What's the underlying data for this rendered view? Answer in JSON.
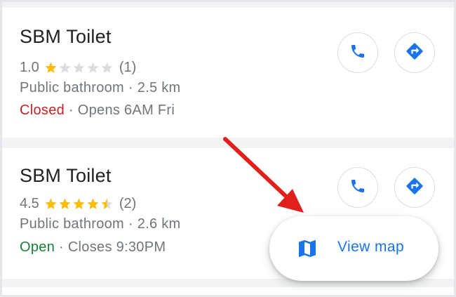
{
  "results": [
    {
      "name": "SBM Toilet",
      "rating": "1.0",
      "stars": [
        1,
        0,
        0,
        0,
        0
      ],
      "review_count": "(1)",
      "category_distance": "Public bathroom · 2.5 km",
      "status": "Closed",
      "status_detail": " · Opens 6AM Fri",
      "call_icon": "phone-icon",
      "directions_icon": "directions-icon"
    },
    {
      "name": "SBM Toilet",
      "rating": "4.5",
      "stars": [
        1,
        1,
        1,
        1,
        0.5
      ],
      "review_count": "(2)",
      "category_distance": "Public bathroom · 2.6 km",
      "status": "Open",
      "status_detail": " · Closes 9:30PM",
      "call_icon": "phone-icon",
      "directions_icon": "directions-icon"
    }
  ],
  "view_map": {
    "label": "View map",
    "icon": "map-icon"
  },
  "colors": {
    "accent": "#1a73e8",
    "star": "#fbbc04",
    "star_empty": "#dadce0",
    "closed": "#c5221f",
    "open": "#188038",
    "annotation_arrow": "#e0201c"
  }
}
